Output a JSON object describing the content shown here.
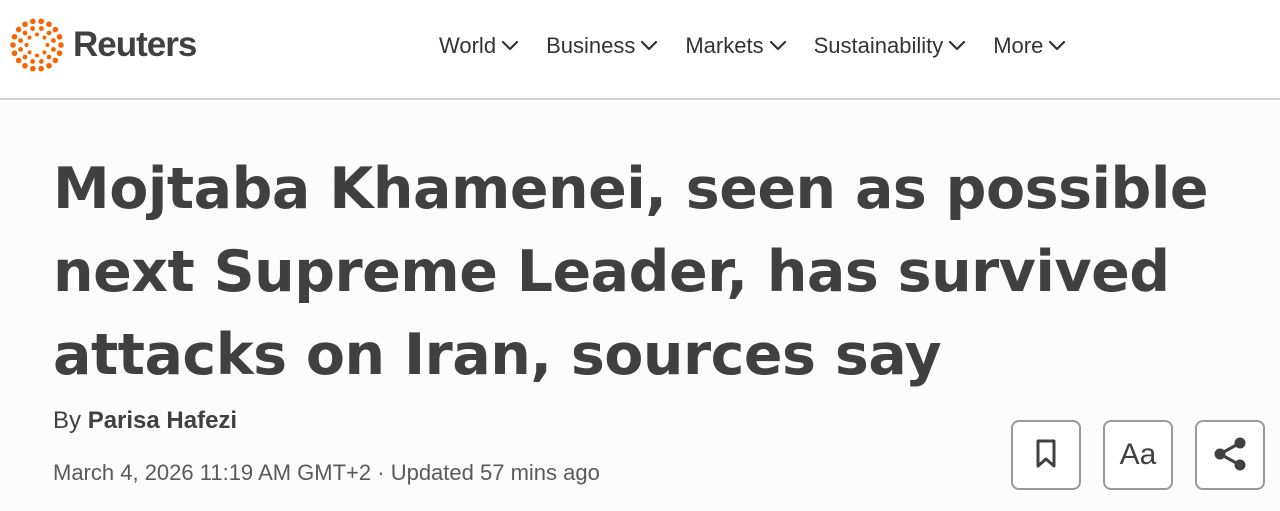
{
  "brand": {
    "name": "Reuters",
    "logo_color": "#fa6400"
  },
  "nav": {
    "items": [
      {
        "label": "World",
        "icon": "chevron-down-icon"
      },
      {
        "label": "Business",
        "icon": "chevron-down-icon"
      },
      {
        "label": "Markets",
        "icon": "chevron-down-icon"
      },
      {
        "label": "Sustainability",
        "icon": "chevron-down-icon"
      },
      {
        "label": "More",
        "icon": "chevron-down-icon"
      }
    ]
  },
  "article": {
    "headline": "Mojtaba Khamenei, seen as possible next Supreme Leader, has survived attacks on Iran, sources say",
    "byline_prefix": "By",
    "author": "Parisa Hafezi",
    "dateline": "March 4, 2026 11:19 AM GMT+2 · Updated 57 mins ago"
  },
  "actions": {
    "bookmark": {
      "icon": "bookmark-icon"
    },
    "text_size": {
      "label": "Aa",
      "icon": "text-size-icon"
    },
    "share": {
      "icon": "share-icon"
    }
  },
  "colors": {
    "text": "#404040",
    "border": "#d4d4d4",
    "accent": "#fa6400"
  }
}
